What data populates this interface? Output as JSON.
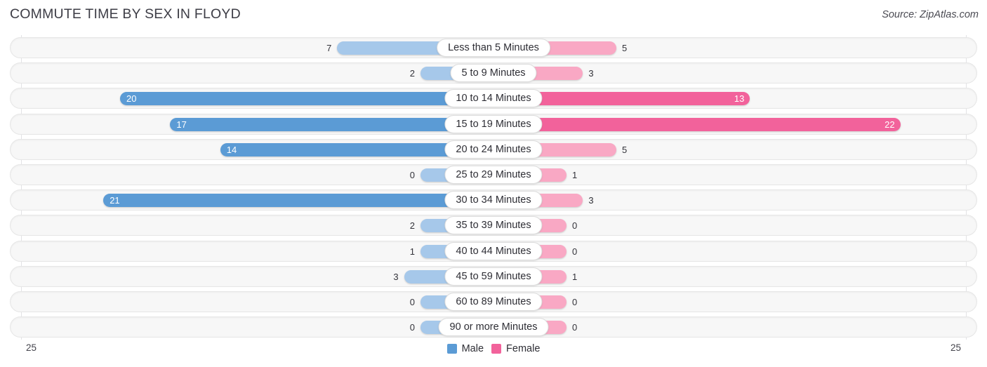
{
  "header": {
    "title": "COMMUTE TIME BY SEX IN FLOYD",
    "source": "Source: ZipAtlas.com"
  },
  "axis": {
    "left_end": "25",
    "right_end": "25"
  },
  "legend": {
    "items": [
      {
        "label": "Male",
        "color": "#5b9bd5"
      },
      {
        "label": "Female",
        "color": "#f2629b"
      }
    ]
  },
  "colors": {
    "male_strong": "#5b9bd5",
    "male_light": "#a6c8ea",
    "female_strong": "#f2629b",
    "female_light": "#f9a8c4",
    "track_fill": "#f7f7f7",
    "track_border": "#e6e6e6",
    "gridline": "#e2e2e5"
  },
  "chart_data": {
    "type": "bar",
    "title": "COMMUTE TIME BY SEX IN FLOYD",
    "subtitle": "Source: ZipAtlas.com",
    "orientation": "horizontal",
    "layout": "diverging-bidirectional",
    "xlabel": "",
    "ylabel": "",
    "xlim": [
      25,
      25
    ],
    "axis_max": 25,
    "grid": true,
    "legend_position": "bottom-center",
    "categories": [
      "Less than 5 Minutes",
      "5 to 9 Minutes",
      "10 to 14 Minutes",
      "15 to 19 Minutes",
      "20 to 24 Minutes",
      "25 to 29 Minutes",
      "30 to 34 Minutes",
      "35 to 39 Minutes",
      "40 to 44 Minutes",
      "45 to 59 Minutes",
      "60 to 89 Minutes",
      "90 or more Minutes"
    ],
    "series": [
      {
        "name": "Male",
        "side": "left",
        "color": "#5b9bd5",
        "values": [
          7,
          2,
          20,
          17,
          14,
          0,
          21,
          2,
          1,
          3,
          0,
          0
        ]
      },
      {
        "name": "Female",
        "side": "right",
        "color": "#f2629b",
        "values": [
          5,
          3,
          13,
          22,
          5,
          1,
          3,
          0,
          0,
          1,
          0,
          0
        ]
      }
    ]
  },
  "rows": [
    {
      "label": "Less than 5 Minutes",
      "male": "7",
      "female": "5"
    },
    {
      "label": "5 to 9 Minutes",
      "male": "2",
      "female": "3"
    },
    {
      "label": "10 to 14 Minutes",
      "male": "20",
      "female": "13"
    },
    {
      "label": "15 to 19 Minutes",
      "male": "17",
      "female": "22"
    },
    {
      "label": "20 to 24 Minutes",
      "male": "14",
      "female": "5"
    },
    {
      "label": "25 to 29 Minutes",
      "male": "0",
      "female": "1"
    },
    {
      "label": "30 to 34 Minutes",
      "male": "21",
      "female": "3"
    },
    {
      "label": "35 to 39 Minutes",
      "male": "2",
      "female": "0"
    },
    {
      "label": "40 to 44 Minutes",
      "male": "1",
      "female": "0"
    },
    {
      "label": "45 to 59 Minutes",
      "male": "3",
      "female": "1"
    },
    {
      "label": "60 to 89 Minutes",
      "male": "0",
      "female": "0"
    },
    {
      "label": "90 or more Minutes",
      "male": "0",
      "female": "0"
    }
  ]
}
